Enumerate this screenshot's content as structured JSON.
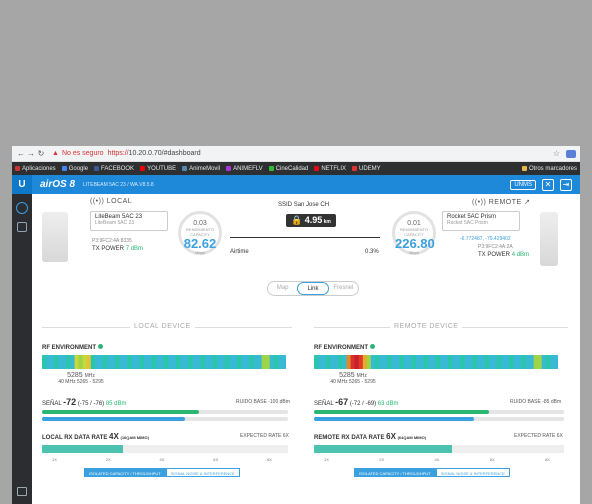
{
  "browser": {
    "insecure_label": "No es seguro",
    "url_scheme": "https://",
    "url_rest": "10.20.0.70/#dashboard",
    "bookmarks": [
      "Aplicaciones",
      "Google",
      "FACEBOOK",
      "YOUTUBE",
      "AnimeMovil",
      "ANIMEFLV",
      "CineCalidad",
      "NETFLIX",
      "UDEMY"
    ],
    "bookmark_colors": [
      "#c33",
      "#4285f4",
      "#3b5998",
      "#e00",
      "#58a",
      "#a3d",
      "#3b3",
      "#e50914",
      "#d33"
    ],
    "other_bookmarks": "Otros marcadores"
  },
  "topbar": {
    "logo": "U",
    "product": "airOS 8",
    "device_version": "LITEBEAM 5AC 23 / WA.V8.5.8",
    "unms": "UNMS"
  },
  "local": {
    "title": "LOCAL",
    "name": "LiteBeam 5AC 23",
    "model": "LiteBeam 5AC 23",
    "gps": "P3:9FC2:4A:8335",
    "tx_power_label": "TX POWER",
    "tx_power_value": "7 dBm",
    "gauge_top": "0.03",
    "gauge_label": "RENDIMIENTO CAPACITY",
    "gauge_value": "82.62",
    "gauge_unit": "Mbps"
  },
  "link": {
    "ssid_label": "SSID",
    "ssid": "San Jose CH",
    "distance": "4.95",
    "distance_unit": "km",
    "airtime_label": "Airtime",
    "airtime_value": "0.3%"
  },
  "remote": {
    "title": "REMOTE",
    "name": "Rocket 5AC Prism",
    "model": "Rocket 5AC Prism",
    "coords": "-6.772487, -79.429402",
    "gps": "P3:9FC2:4A:2A",
    "tx_power_label": "TX POWER",
    "tx_power_value": "4 dBm",
    "gauge_top": "0.01",
    "gauge_label": "RENDIMIENTO CAPACITY",
    "gauge_value": "226.80",
    "gauge_unit": "Mbps"
  },
  "tabs": [
    "Map",
    "Link",
    "Fresnel"
  ],
  "local_section": {
    "header": "LOCAL DEVICE",
    "rf_label": "RF ENVIRONMENT",
    "freq": "5285",
    "freq_unit": "MHz",
    "freq_range": "40 MHz 5265 - 5295",
    "signal_prefix": "SEÑAL",
    "signal_value": "-72",
    "signal_detail": "(-75 / -76)",
    "signal_extra": "85 dBm",
    "noise": "RUIDO BASE -100 dBm",
    "signal_fill": 0.64,
    "noise_fill": 0.58,
    "rx_prefix": "LOCAL RX DATA RATE",
    "rx_value": "4X",
    "rx_mode": "(16QAM MIMO)",
    "expected": "EXPECTED RATE 6X",
    "rate_fill": 0.33,
    "ticks": [
      "1X",
      "2X",
      "4X",
      "6X",
      "8X"
    ],
    "btn_on": "ISOLATED CAPACITY / THROUGHPUT",
    "btn_off": "SIGNAL NOISE & INTERFERENCE"
  },
  "remote_section": {
    "header": "REMOTE DEVICE",
    "rf_label": "RF ENVIRONMENT",
    "freq": "5285",
    "freq_unit": "MHz",
    "freq_range": "40 MHz 5265 - 5295",
    "signal_prefix": "SEÑAL",
    "signal_value": "-67",
    "signal_detail": "(-72 / -69)",
    "signal_extra": "63 dBm",
    "noise": "RUIDO BASE -85 dBm",
    "signal_fill": 0.7,
    "noise_fill": 0.64,
    "rx_prefix": "REMOTE RX DATA RATE",
    "rx_value": "6X",
    "rx_mode": "(64QAM MIMO)",
    "expected": "EXPECTED RATE 6X",
    "rate_fill": 0.55,
    "ticks": [
      "1X",
      "2X",
      "4X",
      "6X",
      "8X"
    ],
    "btn_on": "ISOLATED CAPACITY / THROUGHPUT",
    "btn_off": "SIGNAL NOISE & INTERFERENCE"
  },
  "colors": {
    "brand": "#1e88d9",
    "accent": "#3aa0df",
    "good": "#2bb673"
  }
}
